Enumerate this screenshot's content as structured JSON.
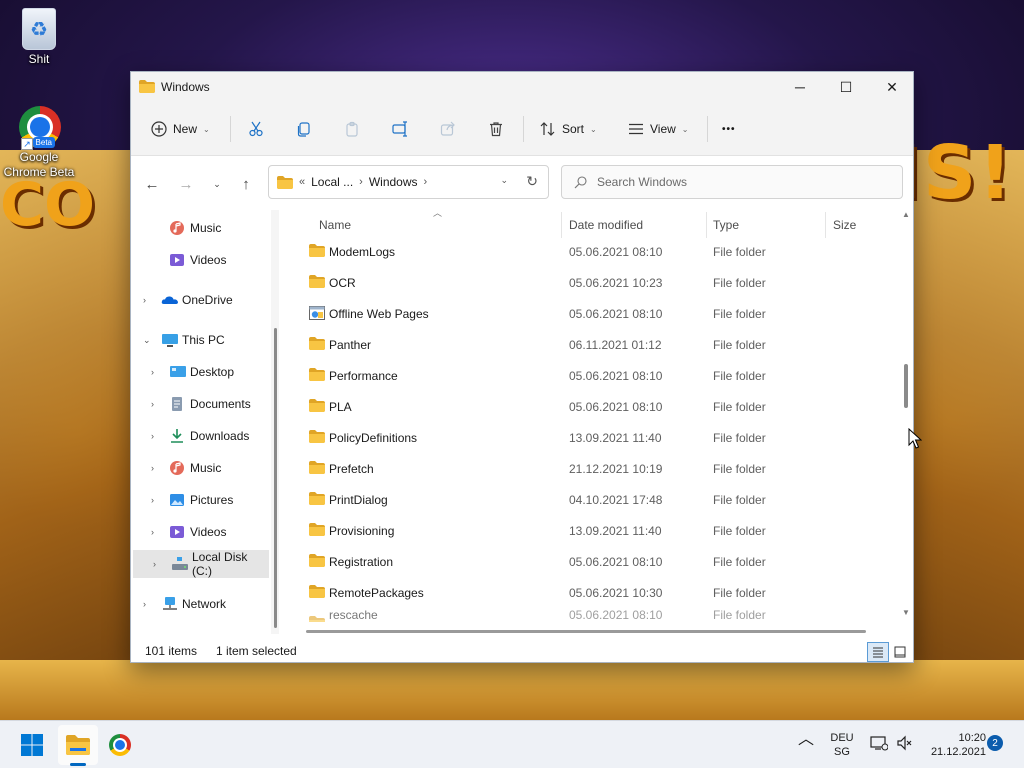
{
  "desktop": {
    "icons": [
      {
        "label": "Shit"
      },
      {
        "label": "Google Chrome Beta",
        "badge": "Beta"
      }
    ],
    "wallpaper_text_right": "IS!",
    "wallpaper_text_left": "CO"
  },
  "window": {
    "title": "Windows",
    "controls": {
      "minimize": "─",
      "maximize": "☐",
      "close": "✕"
    }
  },
  "toolbar": {
    "new_label": "New",
    "sort_label": "Sort",
    "view_label": "View",
    "more_label": "•••"
  },
  "address": {
    "overflow": "«",
    "crumbs": [
      "Local ...",
      "Windows"
    ],
    "separator": "›"
  },
  "search": {
    "placeholder": "Search Windows"
  },
  "nav_pane": {
    "items": [
      {
        "label": "Music"
      },
      {
        "label": "Videos"
      },
      {
        "label": "OneDrive"
      },
      {
        "label": "This PC"
      },
      {
        "label": "Desktop"
      },
      {
        "label": "Documents"
      },
      {
        "label": "Downloads"
      },
      {
        "label": "Music"
      },
      {
        "label": "Pictures"
      },
      {
        "label": "Videos"
      },
      {
        "label": "Local Disk (C:)"
      },
      {
        "label": "Network"
      }
    ]
  },
  "columns": {
    "name": "Name",
    "date": "Date modified",
    "type": "Type",
    "size": "Size"
  },
  "files": [
    {
      "name": "ModemLogs",
      "date": "05.06.2021 08:10",
      "type": "File folder",
      "icon": "folder-icon"
    },
    {
      "name": "OCR",
      "date": "05.06.2021 10:23",
      "type": "File folder",
      "icon": "folder-icon"
    },
    {
      "name": "Offline Web Pages",
      "date": "05.06.2021 08:10",
      "type": "File folder",
      "icon": "web-folder-icon"
    },
    {
      "name": "Panther",
      "date": "06.11.2021 01:12",
      "type": "File folder",
      "icon": "folder-icon"
    },
    {
      "name": "Performance",
      "date": "05.06.2021 08:10",
      "type": "File folder",
      "icon": "folder-icon"
    },
    {
      "name": "PLA",
      "date": "05.06.2021 08:10",
      "type": "File folder",
      "icon": "folder-icon"
    },
    {
      "name": "PolicyDefinitions",
      "date": "13.09.2021 11:40",
      "type": "File folder",
      "icon": "folder-icon"
    },
    {
      "name": "Prefetch",
      "date": "21.12.2021 10:19",
      "type": "File folder",
      "icon": "folder-icon"
    },
    {
      "name": "PrintDialog",
      "date": "04.10.2021 17:48",
      "type": "File folder",
      "icon": "folder-icon"
    },
    {
      "name": "Provisioning",
      "date": "13.09.2021 11:40",
      "type": "File folder",
      "icon": "folder-icon"
    },
    {
      "name": "Registration",
      "date": "05.06.2021 08:10",
      "type": "File folder",
      "icon": "folder-icon"
    },
    {
      "name": "RemotePackages",
      "date": "05.06.2021 10:30",
      "type": "File folder",
      "icon": "folder-icon"
    },
    {
      "name": "rescache",
      "date": "05.06.2021 08:10",
      "type": "File folder",
      "icon": "folder-icon"
    }
  ],
  "status": {
    "count": "101 items",
    "selection": "1 item selected"
  },
  "taskbar": {
    "language": "DEU",
    "layout": "SG",
    "time": "10:20",
    "date": "21.12.2021",
    "notifications": "2",
    "tray_chevron": "︿"
  },
  "colors": {
    "accent": "#0067c0",
    "folder": "#f8c543",
    "folder_dark": "#e0a526",
    "selection": "#e5e5e5"
  }
}
